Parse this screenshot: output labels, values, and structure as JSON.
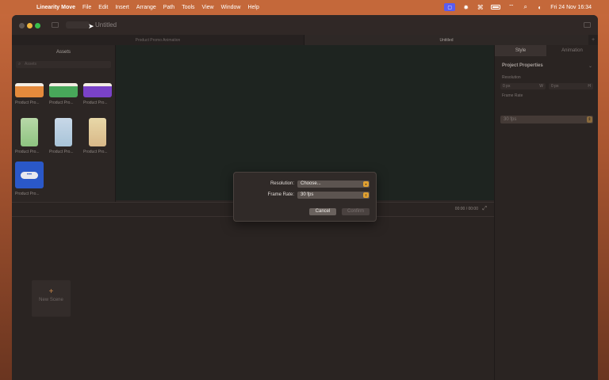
{
  "menubar": {
    "app_name": "Linearity Move",
    "items": [
      "File",
      "Edit",
      "Insert",
      "Arrange",
      "Path",
      "Tools",
      "View",
      "Window",
      "Help"
    ],
    "clock": "Fri 24 Nov  16:34"
  },
  "window": {
    "title": "Untitled",
    "tabs": [
      "Product Promo Animation",
      "Untitled"
    ]
  },
  "assets": {
    "title": "Assets",
    "search_placeholder": "Assets",
    "items": [
      {
        "label": "Product Pro..."
      },
      {
        "label": "Product Pro..."
      },
      {
        "label": "Product Pro..."
      },
      {
        "label": "Product Pro..."
      },
      {
        "label": "Product Pro..."
      },
      {
        "label": "Product Pro..."
      },
      {
        "label": "Product Pro..."
      }
    ]
  },
  "timeline": {
    "time": "00:00 / 00:00"
  },
  "scenes": {
    "new_scene_label": "New Scene",
    "plus": "+"
  },
  "inspector": {
    "tabs": [
      "Style",
      "Animation"
    ],
    "section_title": "Project Properties",
    "resolution_label": "Resolution",
    "width_value": "0 px",
    "width_unit": "W",
    "height_value": "0 px",
    "height_unit": "H",
    "frame_rate_label": "Frame Rate",
    "frame_rate_value": "30 fps"
  },
  "dialog": {
    "resolution_label": "Resolution:",
    "resolution_value": "Choose...",
    "frame_rate_label": "Frame Rate:",
    "frame_rate_value": "30 fps",
    "cancel_label": "Cancel",
    "confirm_label": "Confirm"
  },
  "colors": {
    "accent": "#e0a030",
    "status_purple": "#5a5cf0",
    "dialog_bg": "#302a28",
    "canvas_bg": "#1e2420"
  }
}
